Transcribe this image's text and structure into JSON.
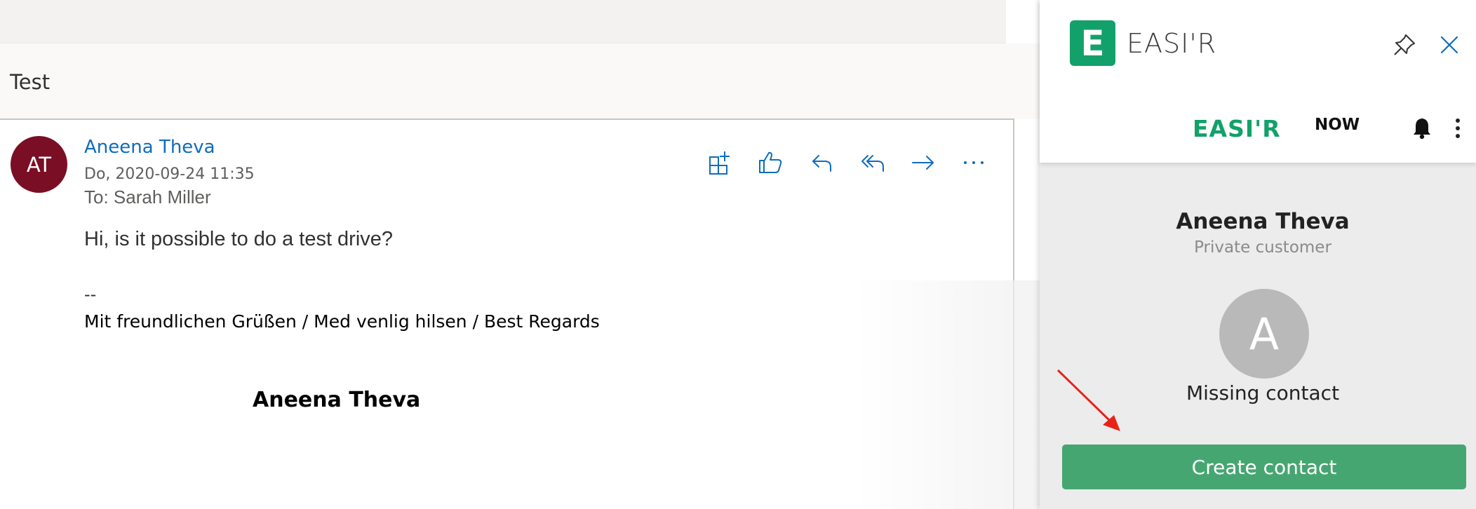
{
  "mail": {
    "subject": "Test",
    "sender_initials": "AT",
    "sender_name": "Aneena Theva",
    "date": "Do, 2020-09-24 11:35",
    "to": "To: Sarah Miller",
    "body": "Hi, is it possible to do a test drive?",
    "signature_dash": "--",
    "signature_greeting": "Mit freundlichen Grüßen / Med venlig hilsen / Best Regards",
    "signature_name": "Aneena Theva",
    "actions": [
      "apps-icon",
      "like-icon",
      "reply-icon",
      "reply-all-icon",
      "forward-icon",
      "more-icon"
    ]
  },
  "panel": {
    "logo_letter": "E",
    "app_title": "EASI'R",
    "brand": "EASI'R",
    "brand_suffix": "NOW",
    "contact_name": "Aneena Theva",
    "contact_type": "Private customer",
    "avatar_letter": "A",
    "missing_label": "Missing contact",
    "create_button": "Create contact"
  },
  "colors": {
    "accent_blue": "#0f6cbd",
    "brand_green": "#12a16a",
    "button_green": "#46a672",
    "avatar_red": "#7a0e24",
    "annotation_red": "#e8231a"
  }
}
